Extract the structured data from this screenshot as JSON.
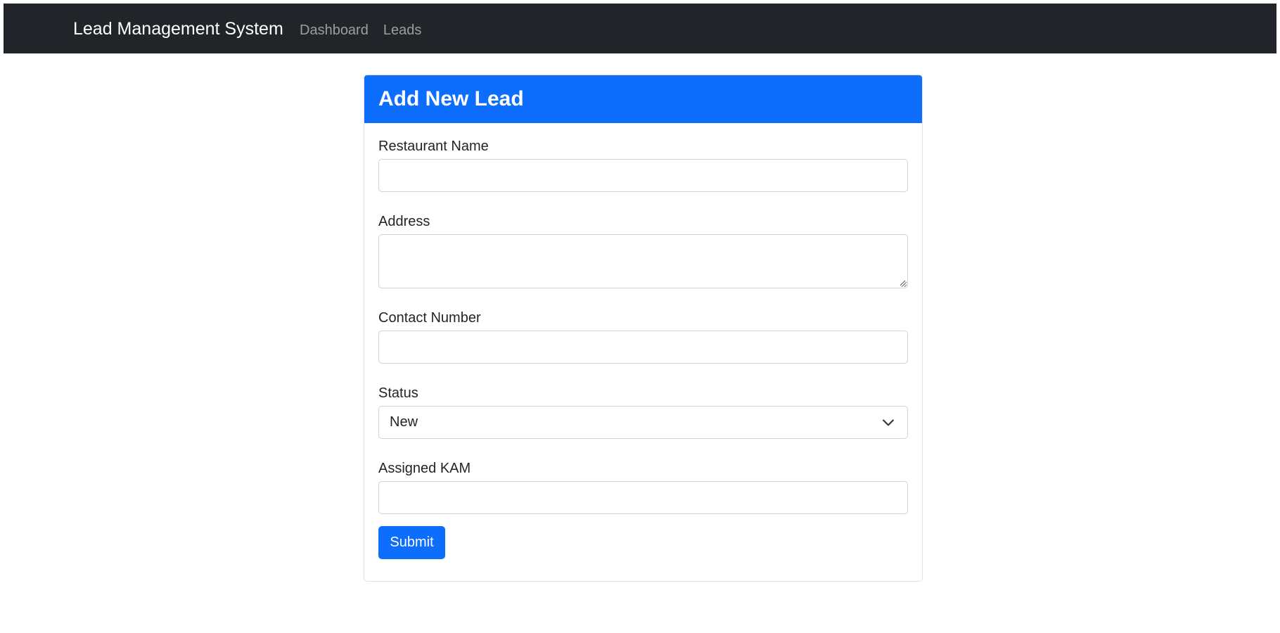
{
  "navbar": {
    "brand": "Lead Management System",
    "links": [
      "Dashboard",
      "Leads"
    ]
  },
  "form": {
    "title": "Add New Lead",
    "fields": {
      "restaurant_name": {
        "label": "Restaurant Name",
        "value": ""
      },
      "address": {
        "label": "Address",
        "value": ""
      },
      "contact_number": {
        "label": "Contact Number",
        "value": ""
      },
      "status": {
        "label": "Status",
        "selected": "New"
      },
      "assigned_kam": {
        "label": "Assigned KAM",
        "value": ""
      }
    },
    "submit_label": "Submit"
  },
  "colors": {
    "navbar_bg": "#212529",
    "primary": "#0d6efd"
  },
  "icons": {
    "status_dropdown": "chevron-down-icon",
    "address_resize": "resize-grip-icon"
  }
}
